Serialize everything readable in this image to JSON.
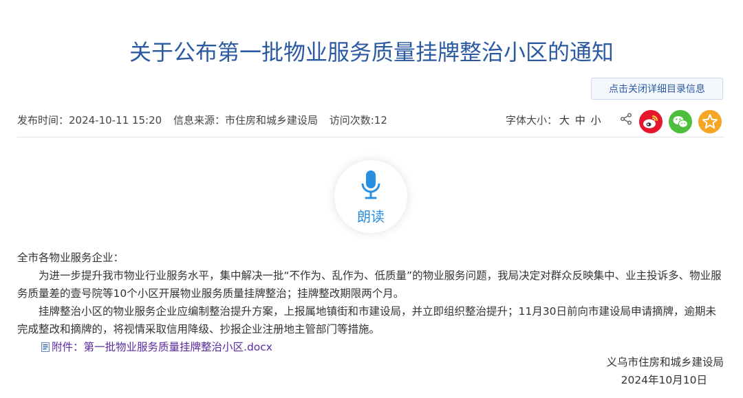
{
  "article": {
    "title": "关于公布第一批物业服务质量挂牌整治小区的通知",
    "catalog_button": "点击关闭详细目录信息",
    "meta": {
      "publish_time": "发布时间：2024-10-11 15:20",
      "source": "信息来源：市住房和城乡建设局",
      "visits": "访问次数:12"
    },
    "font_size": {
      "label": "字体大小：",
      "large": "大",
      "medium": "中",
      "small": "小"
    },
    "social_icons": [
      "share-icon",
      "weibo-icon",
      "wechat-icon",
      "favorite-icon"
    ],
    "read_aloud": "朗读",
    "greeting": "全市各物业服务企业：",
    "paragraphs": [
      "为进一步提升我市物业行业服务水平，集中解决一批“不作为、乱作为、低质量”的物业服务问题，我局决定对群众反映集中、业主投诉多、物业服务质量差的壹号院等10个小区开展物业服务质量挂牌整治；挂牌整改期限两个月。",
      "挂牌整治小区的物业服务企业应编制整治提升方案，上报属地镇街和市建设局，并立即组织整治提升；11月30日前向市建设局申请摘牌，逾期未完成整改和摘牌的，将视情采取信用降级、抄报企业注册地主管部门等措施。"
    ],
    "attachment": {
      "label": "附件：",
      "filename": "第一批物业服务质量挂牌整治小区.docx"
    },
    "signature": {
      "org": "义乌市住房和城乡建设局",
      "date": "2024年10月10日"
    }
  },
  "colors": {
    "title": "#2b5aa3",
    "read_accent": "#2b8fe0",
    "weibo": "#e6162d",
    "wechat": "#4cbf3b",
    "favorite": "#f5a623",
    "attachment_link": "#5a2ca0"
  }
}
